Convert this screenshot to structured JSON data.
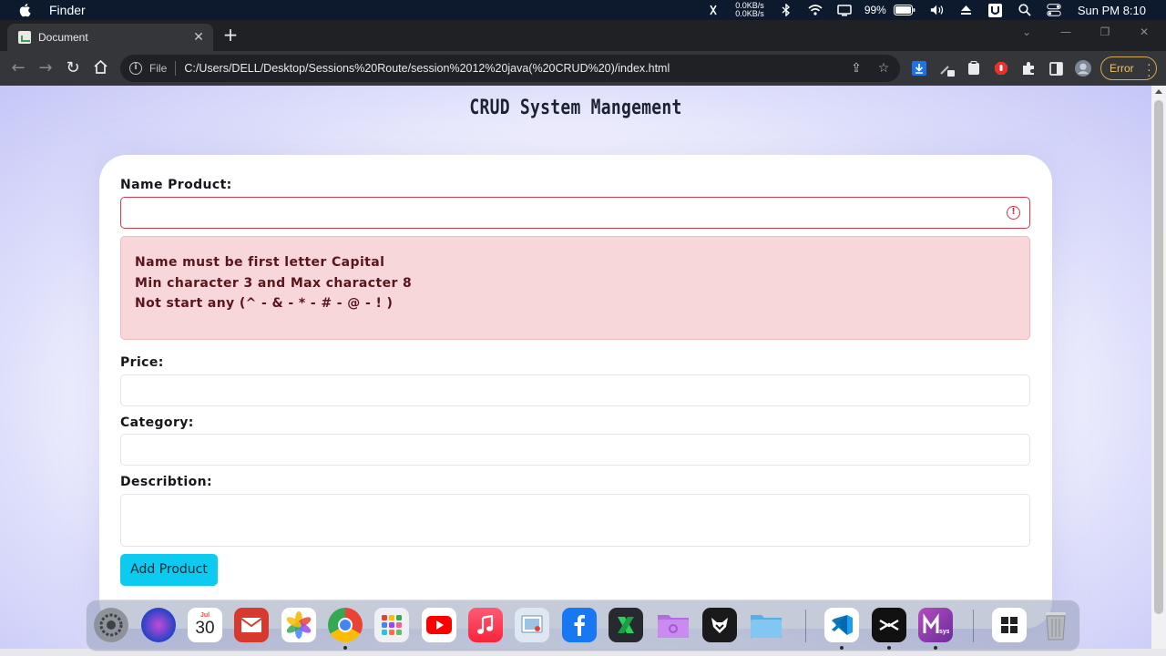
{
  "menubar": {
    "app_name": "Finder",
    "net_up": "0.0KB/s",
    "net_down": "0.0KB/s",
    "battery": "99%",
    "clock": "Sun PM 8:10"
  },
  "browser": {
    "tab_title": "Document",
    "scheme_label": "File",
    "url": "C:/Users/DELL/Desktop/Sessions%20Route/session%2012%20java(%20CRUD%20)/index.html",
    "profile_status": "Error"
  },
  "page": {
    "title": "CRUD System Mangement",
    "form": {
      "name_label": "Name Product:",
      "name_value": "",
      "name_errors": [
        "Name must be first letter Capital",
        "Min character 3 and Max character 8",
        "Not start any (^ - & - * - # - @ - ! )"
      ],
      "price_label": "Price:",
      "price_value": "",
      "category_label": "Category:",
      "category_value": "",
      "description_label": "Describtion:",
      "description_value": "",
      "submit_label": "Add Product"
    }
  },
  "dock": {
    "calendar_day": "30",
    "calendar_month": "Jul"
  },
  "colors": {
    "invalid": "#cf3d4c",
    "alert_bg": "#f8d7da",
    "button": "#0dcaf0",
    "page_gradient": "#c5c6f7"
  }
}
